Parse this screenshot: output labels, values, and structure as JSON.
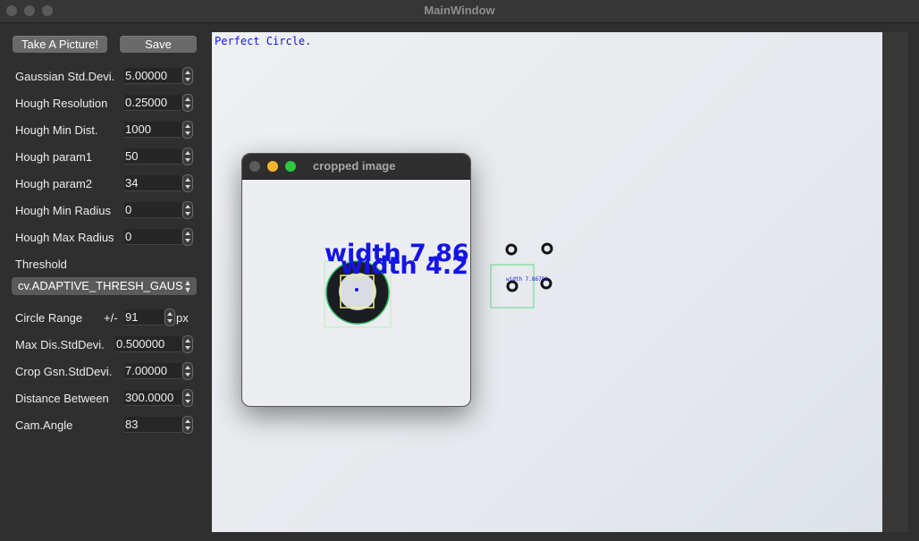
{
  "window": {
    "title": "MainWindow"
  },
  "buttons": {
    "take_picture": "Take A Picture!",
    "save": "Save"
  },
  "params": [
    {
      "label": "Gaussian Std.Devi.",
      "value": "5.00000"
    },
    {
      "label": "Hough Resolution",
      "value": "0.25000"
    },
    {
      "label": "Hough Min Dist.",
      "value": "1000"
    },
    {
      "label": "Hough param1",
      "value": "50"
    },
    {
      "label": "Hough param2",
      "value": "34"
    },
    {
      "label": "Hough Min Radius",
      "value": "0"
    },
    {
      "label": "Hough Max Radius",
      "value": "0"
    }
  ],
  "threshold": {
    "label": "Threshold",
    "selected": "cv.ADAPTIVE_THRESH_GAUS"
  },
  "circle_range": {
    "label": "Circle Range",
    "prefix": "+/-",
    "value": "91",
    "unit": "px"
  },
  "params2": [
    {
      "label": "Max Dis.StdDevi.",
      "value": "0.500000"
    },
    {
      "label": "Crop Gsn.StdDevi.",
      "value": "7.00000"
    },
    {
      "label": "Distance Between",
      "value": "300.0000"
    },
    {
      "label": "Cam.Angle",
      "value": "83"
    }
  ],
  "image": {
    "status_text": "Perfect Circle.",
    "small_label": "width 7.86786",
    "colors": {
      "annotation": "#1414e6",
      "detection": "#5fdc8c"
    }
  },
  "cropped": {
    "title": "cropped image",
    "width_line1": "width 7.86",
    "width_line2": "width 4.2"
  }
}
